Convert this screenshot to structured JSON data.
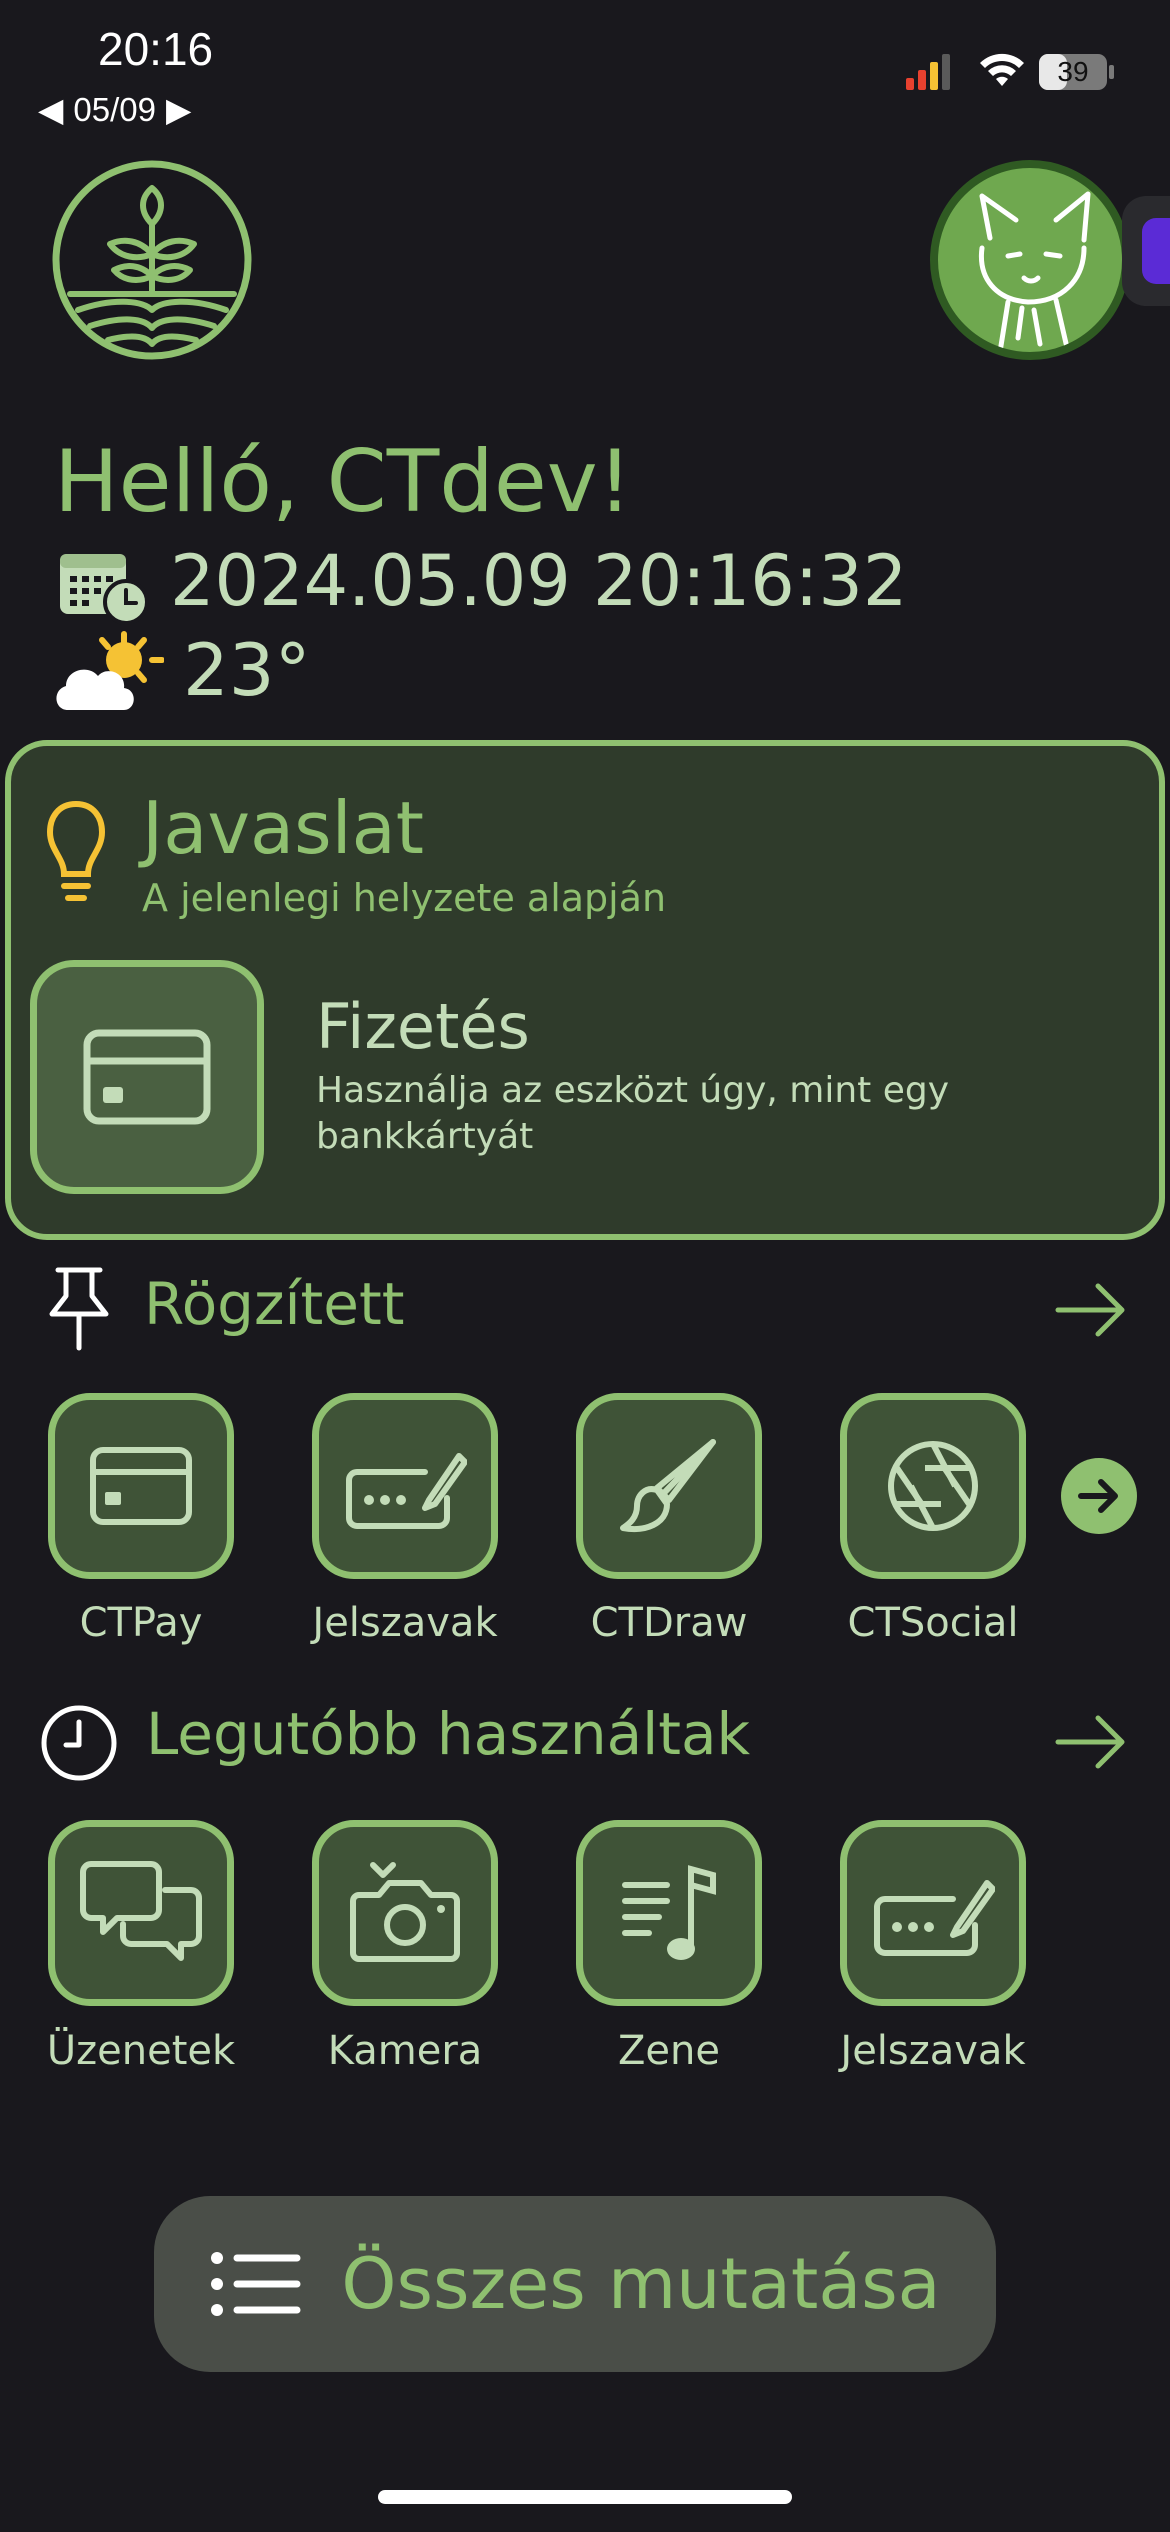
{
  "status_bar": {
    "time": "20:16",
    "date": "05/09",
    "battery": "39"
  },
  "header": {
    "greeting": "Helló, CTdev!",
    "datetime": "2024.05.09 20:16:32",
    "temperature": "23°"
  },
  "suggestion": {
    "title": "Javaslat",
    "subtitle": "A jelenlegi helyzete alapján",
    "item_title": "Fizetés",
    "item_description": "Használja az eszközt úgy, mint egy bankkártyát"
  },
  "pinned": {
    "title": "Rögzített",
    "apps": [
      {
        "label": "CTPay",
        "icon": "credit-card-icon"
      },
      {
        "label": "Jelszavak",
        "icon": "password-icon"
      },
      {
        "label": "CTDraw",
        "icon": "brush-icon"
      },
      {
        "label": "CTSocial",
        "icon": "aperture-icon"
      }
    ]
  },
  "recent": {
    "title": "Legutóbb használtak",
    "apps": [
      {
        "label": "Üzenetek",
        "icon": "chat-icon"
      },
      {
        "label": "Kamera",
        "icon": "camera-icon"
      },
      {
        "label": "Zene",
        "icon": "music-icon"
      },
      {
        "label": "Jelszavak",
        "icon": "password-icon"
      }
    ]
  },
  "footer": {
    "show_all": "Összes mutatása"
  },
  "colors": {
    "background": "#19181d",
    "accent": "#8fc070",
    "card": "#2f3b2b",
    "text_light": "#c3dcb8"
  }
}
